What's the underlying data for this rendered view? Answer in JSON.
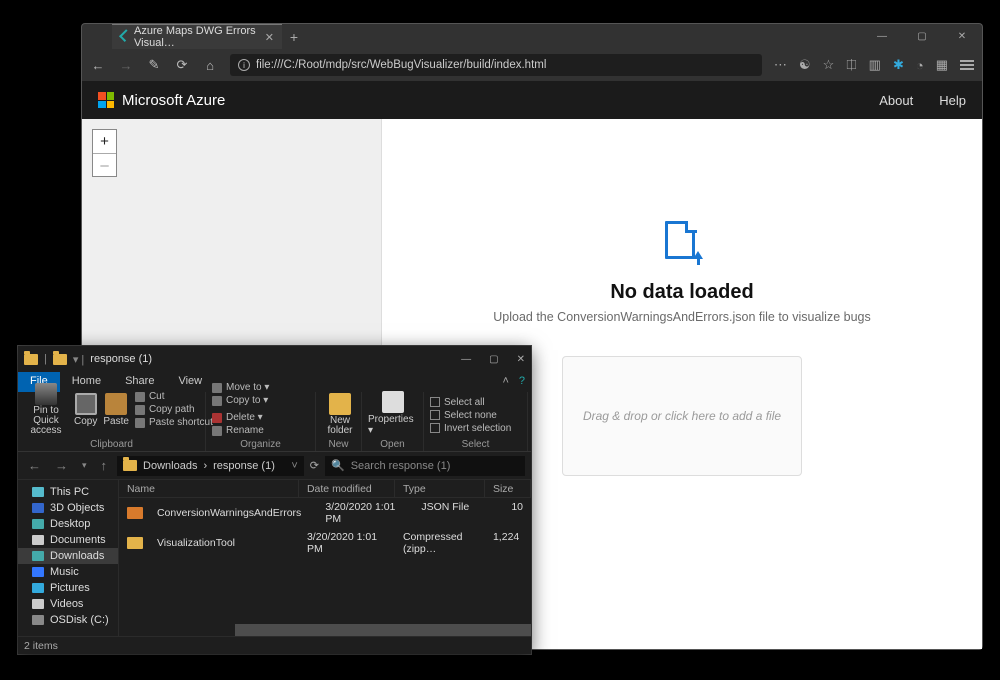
{
  "browser": {
    "tab": {
      "title": "Azure Maps DWG Errors Visual…"
    },
    "url": "file:///C:/Root/mdp/src/WebBugVisualizer/build/index.html"
  },
  "azure": {
    "brand": "Microsoft Azure",
    "links": {
      "about": "About",
      "help": "Help"
    }
  },
  "zoom": {
    "in": "+",
    "out": "–"
  },
  "page": {
    "heading": "No data loaded",
    "subtext": "Upload the ConversionWarningsAndErrors.json file to visualize bugs",
    "dropzone": "Drag & drop or click here to add a file"
  },
  "explorer": {
    "title": "response (1)",
    "tabs": {
      "file": "File",
      "home": "Home",
      "share": "Share",
      "view": "View"
    },
    "ribbon": {
      "clipboard": {
        "label": "Clipboard",
        "pin": "Pin to Quick access",
        "copy": "Copy",
        "paste": "Paste",
        "cut": "Cut",
        "copypath": "Copy path",
        "pasteshortcut": "Paste shortcut"
      },
      "organize": {
        "label": "Organize",
        "moveto": "Move to ▾",
        "copyto": "Copy to ▾",
        "delete": "Delete ▾",
        "rename": "Rename"
      },
      "new": {
        "label": "New",
        "newfolder": "New folder"
      },
      "open": {
        "label": "Open",
        "properties": "Properties ▾"
      },
      "select": {
        "label": "Select",
        "selectall": "Select all",
        "selectnone": "Select none",
        "invert": "Invert selection"
      }
    },
    "breadcrumb": {
      "a": "Downloads",
      "b": "response (1)"
    },
    "search_placeholder": "Search response (1)",
    "columns": {
      "name": "Name",
      "date": "Date modified",
      "type": "Type",
      "size": "Size"
    },
    "rows": [
      {
        "name": "ConversionWarningsAndErrors",
        "date": "3/20/2020 1:01 PM",
        "type": "JSON File",
        "size": "10"
      },
      {
        "name": "VisualizationTool",
        "date": "3/20/2020 1:01 PM",
        "type": "Compressed (zipp…",
        "size": "1,224"
      }
    ],
    "tree": {
      "thispc": "This PC",
      "objects3d": "3D Objects",
      "desktop": "Desktop",
      "documents": "Documents",
      "downloads": "Downloads",
      "music": "Music",
      "pictures": "Pictures",
      "videos": "Videos",
      "osdisk": "OSDisk (C:)"
    },
    "status": "2 items"
  }
}
